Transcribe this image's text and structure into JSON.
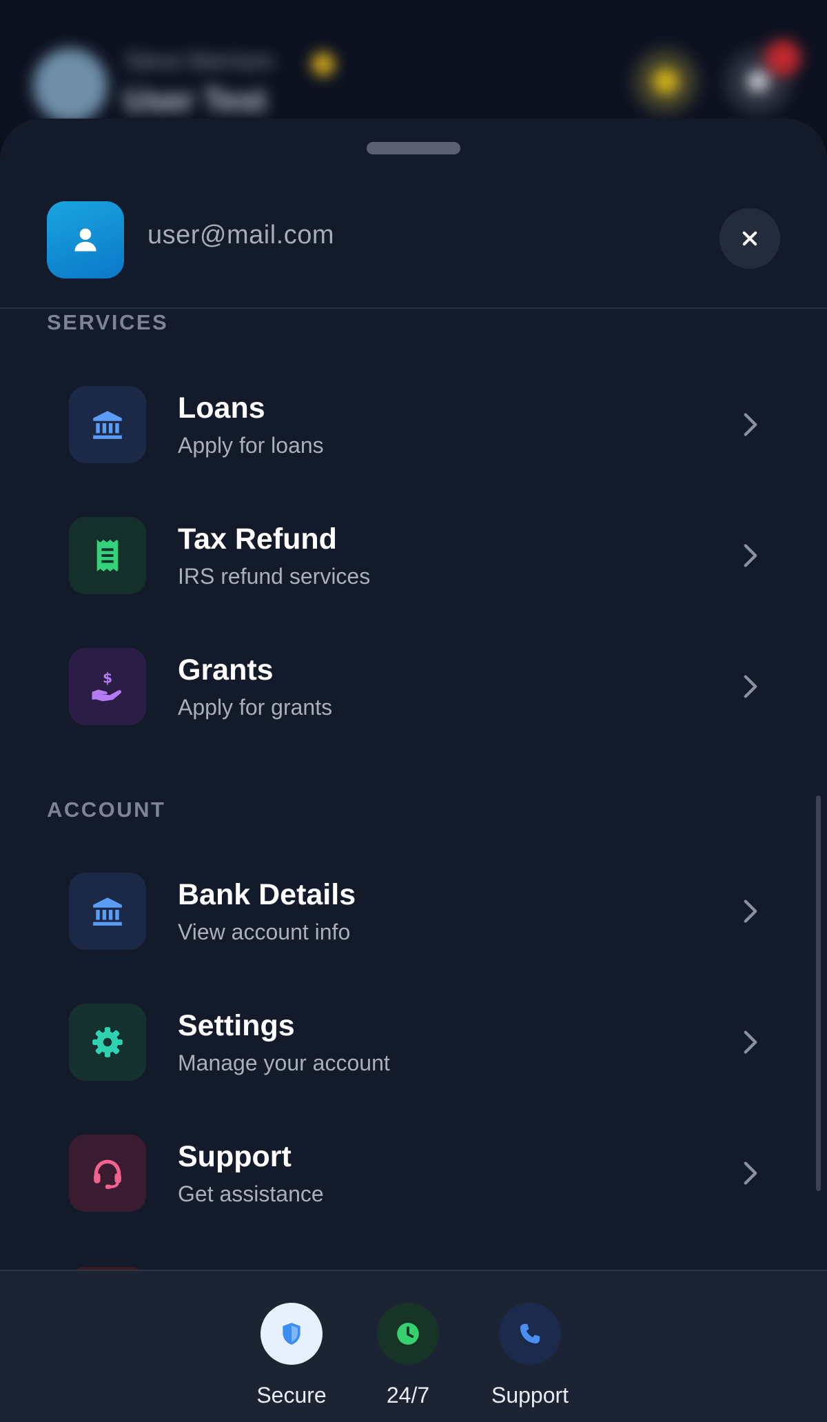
{
  "background_header": {
    "name": "Steve Marrison",
    "title": "User Test"
  },
  "sheet": {
    "email": "user@mail.com",
    "close_icon": "close-icon"
  },
  "sections": {
    "services": {
      "title": "SERVICES",
      "items": [
        {
          "title": "Loans",
          "subtitle": "Apply for loans",
          "icon": "bank-icon",
          "color": "#5b9cf5",
          "bg": "#1b2846"
        },
        {
          "title": "Tax Refund",
          "subtitle": "IRS refund services",
          "icon": "receipt-icon",
          "color": "#34d27a",
          "bg": "#15302a"
        },
        {
          "title": "Grants",
          "subtitle": "Apply for grants",
          "icon": "hand-dollar-icon",
          "color": "#b57bf2",
          "bg": "#2b1e46"
        }
      ]
    },
    "account": {
      "title": "ACCOUNT",
      "items": [
        {
          "title": "Bank Details",
          "subtitle": "View account info",
          "icon": "bank-icon",
          "color": "#5b9cf5",
          "bg": "#1b2846"
        },
        {
          "title": "Settings",
          "subtitle": "Manage your account",
          "icon": "gear-icon",
          "color": "#2ed1b0",
          "bg": "#14302f"
        },
        {
          "title": "Support",
          "subtitle": "Get assistance",
          "icon": "headset-icon",
          "color": "#f0638e",
          "bg": "#3a1c30"
        }
      ]
    }
  },
  "footer": {
    "items": [
      {
        "label": "Secure",
        "icon": "shield-icon",
        "color": "#3b8ef0",
        "bg": "#e6f1fb"
      },
      {
        "label": "24/7",
        "icon": "clock-icon",
        "color": "#36d06f",
        "bg": "#173328"
      },
      {
        "label": "Support",
        "icon": "phone-icon",
        "color": "#4a8ef2",
        "bg": "#1b2a4a"
      }
    ]
  }
}
